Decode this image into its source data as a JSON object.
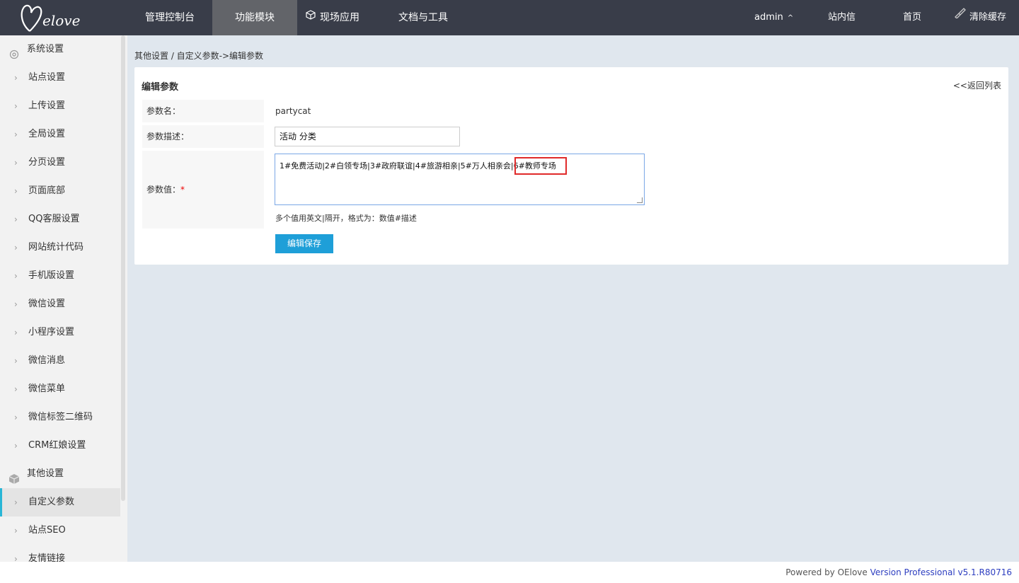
{
  "topnav": {
    "logo_text": "Oelove",
    "items": [
      "管理控制台",
      "功能模块",
      "现场应用",
      "文档与工具"
    ],
    "right": {
      "user": "admin",
      "user_caret": "^",
      "messages": "站内信",
      "home": "首页",
      "clear_cache": "清除缓存"
    }
  },
  "sidebar": {
    "group1": "系统设置",
    "items1": [
      "站点设置",
      "上传设置",
      "全局设置",
      "分页设置",
      "页面底部",
      "QQ客服设置",
      "网站统计代码",
      "手机版设置",
      "微信设置",
      "小程序设置",
      "微信消息",
      "微信菜单",
      "微信标签二维码",
      "CRM红娘设置"
    ],
    "group2": "其他设置",
    "items2": [
      "自定义参数",
      "站点SEO",
      "友情链接"
    ],
    "active": "自定义参数"
  },
  "breadcrumb": "其他设置 / 自定义参数->编辑参数",
  "panel": {
    "title": "编辑参数",
    "back": "<<返回列表",
    "name_label": "参数名：",
    "name_value": "partycat",
    "desc_label": "参数描述：",
    "desc_value": "活动 分类",
    "value_label": "参数值：",
    "required_mark": "*",
    "value_text": "1#免费活动|2#白领专场|3#政府联谊|4#旅游相亲|5#万人相亲会|6#教师专场",
    "hint": "多个值用英文|隔开，格式为：数值#描述",
    "save": "编辑保存"
  },
  "footer": {
    "powered": "Powered by OElove ",
    "version": "Version Professional v5.1.R80716"
  },
  "colors": {
    "topbar": "#393d49",
    "active_nav": "#626469",
    "accent": "#29b6d6",
    "button": "#1e9fd8",
    "highlight": "#e02a2a"
  }
}
